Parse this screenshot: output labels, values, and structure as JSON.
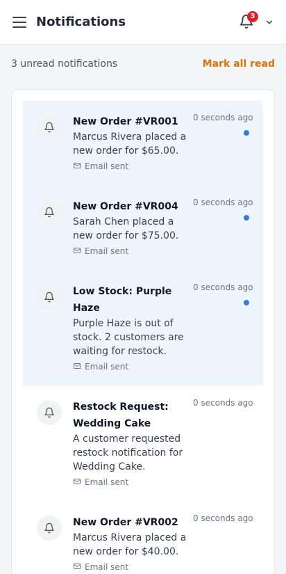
{
  "header": {
    "title": "Notifications",
    "badge_count": "3"
  },
  "summary": {
    "unread_text": "3 unread notifications",
    "mark_all_label": "Mark all read"
  },
  "notifications": [
    {
      "title": "New Order #VR001",
      "body": "Marcus Rivera placed a new order for $65.00.",
      "time": "0 seconds ago",
      "email_status": "Email sent",
      "unread": true
    },
    {
      "title": "New Order #VR004",
      "body": "Sarah Chen placed a new order for $75.00.",
      "time": "0 seconds ago",
      "email_status": "Email sent",
      "unread": true
    },
    {
      "title": "Low Stock: Purple Haze",
      "body": "Purple Haze is out of stock. 2 customers are waiting for restock.",
      "time": "0 seconds ago",
      "email_status": "Email sent",
      "unread": true
    },
    {
      "title": "Restock Request: Wedding Cake",
      "body": "A customer requested restock notification for Wedding Cake.",
      "time": "0 seconds ago",
      "email_status": "Email sent",
      "unread": false
    },
    {
      "title": "New Order #VR002",
      "body": "Marcus Rivera placed a new order for $40.00.",
      "time": "0 seconds ago",
      "email_status": "Email sent",
      "unread": false
    }
  ],
  "colors": {
    "accent": "#d97706",
    "unread_bg": "#eef5fd",
    "unread_dot": "#2f7ae5",
    "badge": "#e11d2e"
  },
  "icons": {
    "menu": "menu-icon",
    "bell": "bell-icon",
    "chevron": "chevron-down-icon",
    "email": "mail-icon"
  }
}
